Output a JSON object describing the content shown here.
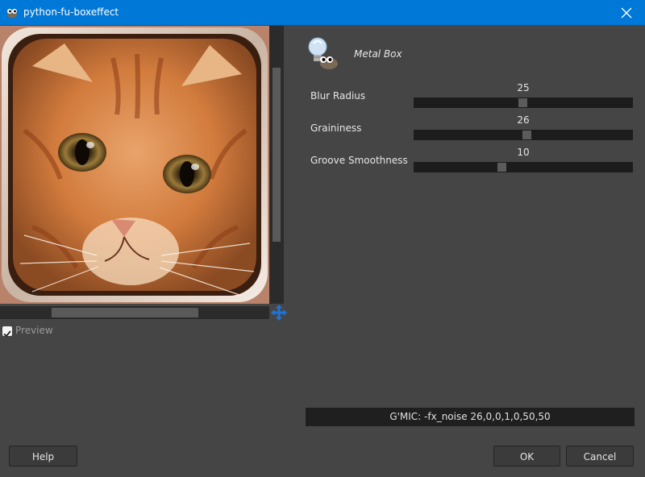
{
  "window": {
    "title": "python-fu-boxeffect",
    "accent": "#0078d7"
  },
  "preview": {
    "checkbox_label": "Preview",
    "checked": true
  },
  "plugin": {
    "title": "Metal Box"
  },
  "params": [
    {
      "label": "Blur Radius",
      "value": "25"
    },
    {
      "label": "Graininess",
      "value": "26"
    },
    {
      "label": "Groove Smoothness",
      "value": "10"
    }
  ],
  "gmic": {
    "command": "G'MIC: -fx_noise 26,0,0,1,0,50,50"
  },
  "buttons": {
    "help": "Help",
    "ok": "OK",
    "cancel": "Cancel"
  }
}
